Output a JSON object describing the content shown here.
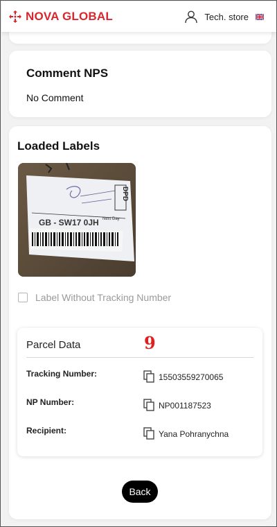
{
  "header": {
    "brand": "NOVA GLOBAL",
    "brand_color": "#d8262f",
    "user_icon": "user-icon",
    "store_label": "Tech. store",
    "language_flag": "uk-flag-icon"
  },
  "comment_nps": {
    "title": "Comment NPS",
    "value": "No Comment"
  },
  "loaded_labels": {
    "title": "Loaded Labels",
    "label_photo_text": {
      "carrier": "DPD",
      "postcode": "GB - SW17 0JH",
      "service": "Next Day"
    },
    "checkbox_label": "Label Without Tracking Number",
    "checkbox_checked": false
  },
  "parcel_data": {
    "title": "Parcel Data",
    "marker": "9",
    "rows": [
      {
        "label": "Tracking Number:",
        "value": "15503559270065"
      },
      {
        "label": "NP Number:",
        "value": "NP001187523"
      },
      {
        "label": "Recipient:",
        "value": "Yana Pohranychna"
      }
    ]
  },
  "actions": {
    "back_label": "Back"
  }
}
